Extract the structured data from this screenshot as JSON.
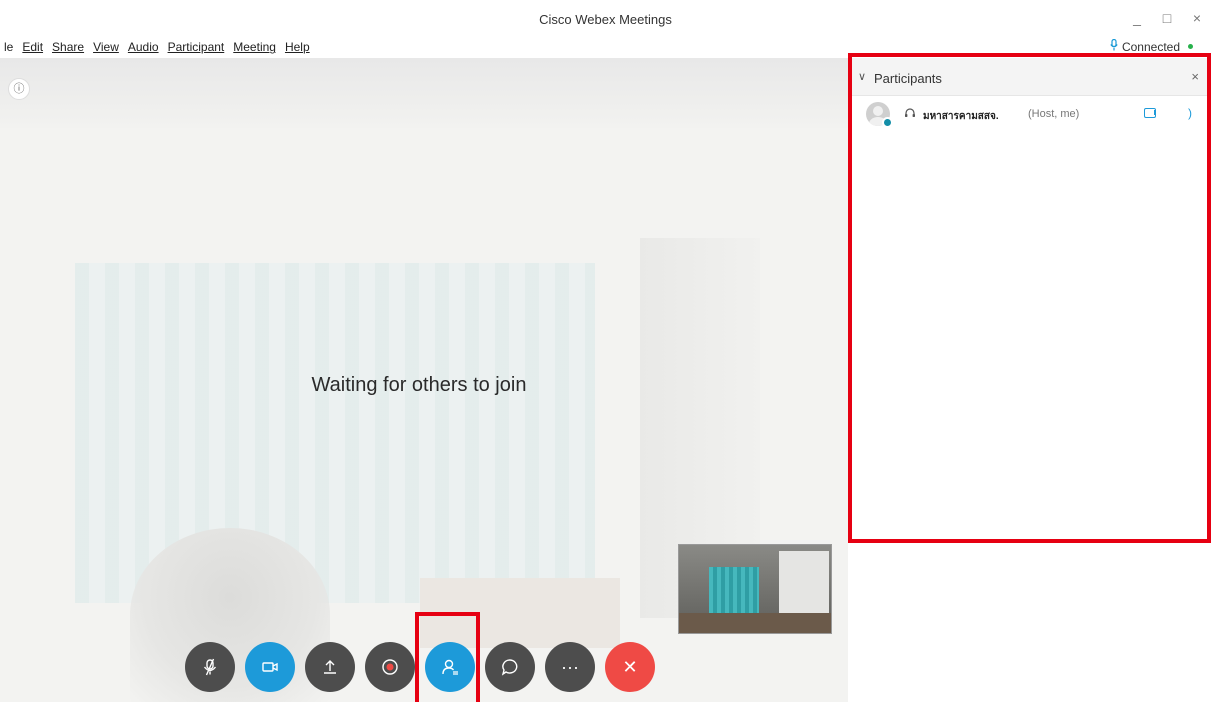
{
  "window": {
    "title": "Cisco Webex Meetings",
    "minimize_glyph": "_",
    "maximize_glyph": "□",
    "close_glyph": "×"
  },
  "menu": {
    "items": [
      {
        "label": "le"
      },
      {
        "label": "Edit"
      },
      {
        "label": "Share"
      },
      {
        "label": "View"
      },
      {
        "label": "Audio"
      },
      {
        "label": "Participant"
      },
      {
        "label": "Meeting"
      },
      {
        "label": "Help"
      }
    ]
  },
  "status": {
    "label": "Connected",
    "color": "#27b14b"
  },
  "stage": {
    "message": "Waiting for others to join",
    "info_glyph": "ⓘ"
  },
  "controls": {
    "mute": {
      "icon": "mic-muted-icon"
    },
    "video": {
      "icon": "video-camera-icon",
      "color": "#1d9ad9"
    },
    "share": {
      "icon": "share-upload-icon"
    },
    "record": {
      "icon": "record-icon"
    },
    "participants": {
      "icon": "participants-icon",
      "color": "#1d9ad9"
    },
    "chat": {
      "icon": "chat-bubble-icon"
    },
    "more": {
      "icon": "more-options-icon",
      "glyph": "···"
    },
    "leave": {
      "icon": "leave-meeting-icon",
      "glyph": "✕",
      "color": "#ef4a45"
    }
  },
  "panel": {
    "title": "Participants",
    "chevron": "∨",
    "close_glyph": "×",
    "participants": [
      {
        "name": "มหาสารคามสสจ.",
        "role": "(Host, me)",
        "more_glyph": ")"
      }
    ]
  },
  "highlight_color": "#e60012"
}
